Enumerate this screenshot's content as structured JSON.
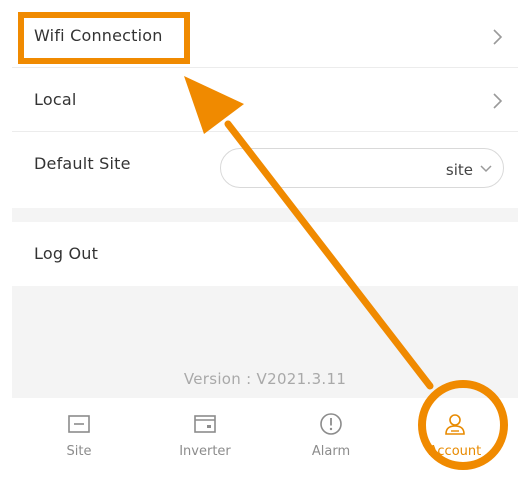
{
  "settings": {
    "wifi_label": "Wifi Connection",
    "local_label": "Local",
    "default_site_label": "Default Site",
    "default_site_value": "site",
    "logout_label": "Log Out"
  },
  "footer": {
    "version": "Version : V2021.3.11"
  },
  "tabbar": {
    "tabs": [
      {
        "label": "Site",
        "icon": "site-icon"
      },
      {
        "label": "Inverter",
        "icon": "inverter-icon"
      },
      {
        "label": "Alarm",
        "icon": "alarm-icon"
      },
      {
        "label": "Account",
        "icon": "account-icon",
        "active": true
      }
    ]
  },
  "colors": {
    "accent": "#f08a00",
    "active_tab": "#e88a00",
    "text": "#333333",
    "muted": "#a9a9a9",
    "background_gray": "#f4f4f4"
  }
}
